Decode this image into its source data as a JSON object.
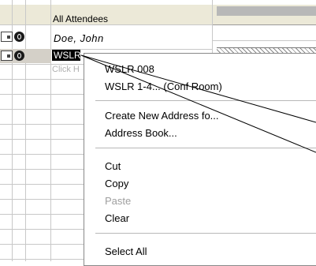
{
  "grid": {
    "header_title": "All Attendees",
    "rows": [
      {
        "name": "Doe, John"
      },
      {
        "name": "WSLR"
      }
    ],
    "click_hint": "Click H"
  },
  "menu": {
    "items": [
      {
        "label": "WSLR 008",
        "enabled": true
      },
      {
        "label": "WSLR 1-4... (Conf Room)",
        "enabled": true
      },
      {
        "label": "Create New Address fo...",
        "enabled": true
      },
      {
        "label": "Address Book...",
        "enabled": true
      },
      {
        "label": "Cut",
        "enabled": true
      },
      {
        "label": "Copy",
        "enabled": true
      },
      {
        "label": "Paste",
        "enabled": false
      },
      {
        "label": "Clear",
        "enabled": true
      },
      {
        "label": "Select All",
        "enabled": true
      }
    ]
  },
  "icons": {
    "calendar": "calendar-icon",
    "attendee_required": "attendee-required-icon",
    "attendee_optional": "attendee-optional-icon"
  },
  "colors": {
    "header_bg": "#ece9d8",
    "selection": "#000000",
    "disabled_text": "#9e9e9e"
  }
}
